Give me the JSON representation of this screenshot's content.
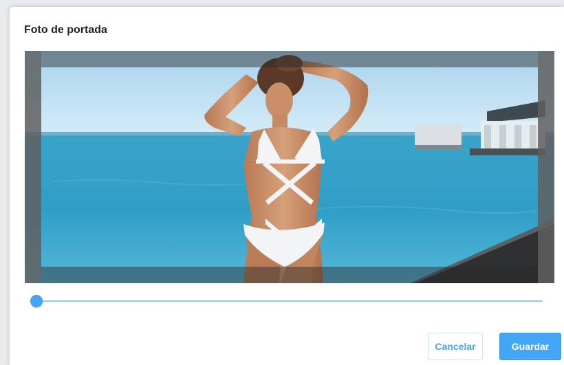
{
  "dialog": {
    "title": "Foto de portada"
  },
  "zoom_slider": {
    "value": 0.0
  },
  "buttons": {
    "cancel_label": "Cancelar",
    "save_label": "Guardar"
  },
  "colors": {
    "accent": "#42a5f5",
    "slider_track": "#8fc8f3",
    "title_text": "#1d2129"
  }
}
